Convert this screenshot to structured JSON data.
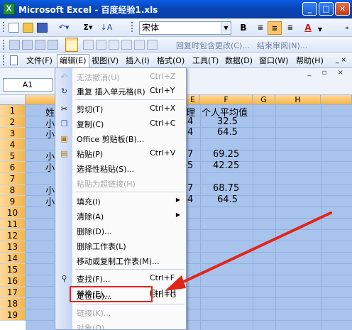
{
  "window": {
    "title": "Microsoft Excel - 百度经验1.xls",
    "app_icon": "excel-icon",
    "controls": [
      "minimize-icon",
      "maximize-icon",
      "close-icon"
    ]
  },
  "toolbar": {
    "font_name": "宋体",
    "bold": "B",
    "sum_label": "Σ",
    "faded_items": [
      "回复时包含更改(C)...",
      "结束审阅(N)..."
    ],
    "font_color_label": "A"
  },
  "menubar": {
    "items": [
      "文件(F)",
      "编辑(E)",
      "视图(V)",
      "插入(I)",
      "格式(O)",
      "工具(T)",
      "数据(D)",
      "窗口(W)",
      "帮助(H)"
    ],
    "active": "编辑(E)"
  },
  "formula_bar": {
    "name_box": "A1",
    "window_controls": "_ ▫ ×"
  },
  "sheet": {
    "columns": [
      "E",
      "F",
      "G",
      "H"
    ],
    "rows": [
      "1",
      "2",
      "3",
      "4",
      "5",
      "6",
      "7",
      "8",
      "9",
      "10",
      "11",
      "12",
      "13",
      "14",
      "15",
      "16",
      "17",
      "18",
      "19"
    ],
    "cells": {
      "r1_a": "姓",
      "r1_e": "理",
      "r1_f": "个人平均值",
      "r2_a": "小",
      "r2_e": "4",
      "r2_f": "32.5",
      "r3_a": "小",
      "r3_e": "4",
      "r3_f": "64.5",
      "r5_a": "小",
      "r5_e": "7",
      "r5_f": "69.25",
      "r6_a": "小",
      "r6_e": "5",
      "r6_f": "42.25",
      "r8_a": "小",
      "r8_e": "7",
      "r8_f": "68.75",
      "r9_a": "小",
      "r9_e": "4",
      "r9_f": "64.5"
    }
  },
  "edit_menu": {
    "items": [
      {
        "label": "无法撤消(U)",
        "shortcut": "Ctrl+Z",
        "icon": "undo-icon"
      },
      {
        "label": "重复 插入单元格(R)",
        "shortcut": "Ctrl+Y",
        "icon": "redo-icon"
      },
      {
        "label": "剪切(T)",
        "shortcut": "Ctrl+X",
        "icon": "scissors-icon"
      },
      {
        "label": "复制(C)",
        "shortcut": "Ctrl+C",
        "icon": "copy-icon"
      },
      {
        "label": "Office 剪贴板(B)...",
        "shortcut": "",
        "icon": "clipboard-icon"
      },
      {
        "label": "粘贴(P)",
        "shortcut": "Ctrl+V",
        "icon": "paste-icon"
      },
      {
        "label": "选择性粘贴(S)...",
        "shortcut": "",
        "icon": ""
      },
      {
        "label": "粘贴为超链接(H)",
        "shortcut": "",
        "icon": ""
      },
      {
        "label": "填充(I)",
        "shortcut": "",
        "icon": ""
      },
      {
        "label": "清除(A)",
        "shortcut": "",
        "icon": ""
      },
      {
        "label": "删除(D)...",
        "shortcut": "",
        "icon": ""
      },
      {
        "label": "删除工作表(L)",
        "shortcut": "",
        "icon": ""
      },
      {
        "label": "移动或复制工作表(M)...",
        "shortcut": "",
        "icon": ""
      },
      {
        "label": "查找(F)...",
        "shortcut": "Ctrl+F",
        "icon": "binoculars-icon"
      },
      {
        "label": "替换(E)...",
        "shortcut": "Ctrl+H",
        "icon": ""
      },
      {
        "label": "定位(G)...",
        "shortcut": "Ctrl+G",
        "icon": ""
      },
      {
        "label": "链接(K)...",
        "shortcut": "",
        "icon": ""
      },
      {
        "label": "对象(O)",
        "shortcut": "",
        "icon": ""
      }
    ]
  },
  "colors": {
    "title_bar": "#0a5ce6",
    "selection": "#a8c4ec",
    "highlight_box": "#e1251b",
    "arrow": "#e1251b"
  }
}
